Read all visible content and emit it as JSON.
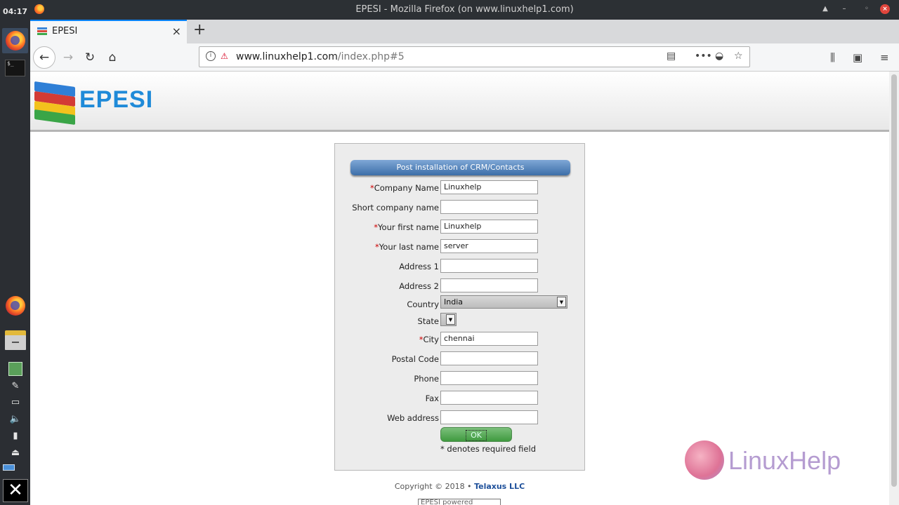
{
  "taskbar": {
    "time": "04:17",
    "terminal_prompt": "$_"
  },
  "window": {
    "title": "EPESI - Mozilla Firefox (on www.linuxhelp1.com)"
  },
  "tab": {
    "label": "EPESI",
    "close": "×",
    "new_tab": "+"
  },
  "nav": {
    "url_domain": "www.linuxhelp1.com",
    "url_path": "/index.php#5",
    "icons": [
      "back-icon",
      "forward-icon",
      "reload-icon",
      "home-icon",
      "info-icon",
      "insecure-icon",
      "reader-icon",
      "more-icon",
      "pocket-icon",
      "bookmark-star-icon",
      "library-icon",
      "sidebar-icon",
      "menu-icon"
    ]
  },
  "brand": {
    "logo_text": "EPESI"
  },
  "form": {
    "title": "Post installation of CRM/Contacts",
    "required_mark": "*",
    "fields": {
      "company_name": {
        "label": "Company Name",
        "value": "Linuxhelp"
      },
      "short_company_name": {
        "label": "Short company name",
        "value": ""
      },
      "first_name": {
        "label": "Your first name",
        "value": "Linuxhelp"
      },
      "last_name": {
        "label": "Your last name",
        "value": "server"
      },
      "address1": {
        "label": "Address 1",
        "value": ""
      },
      "address2": {
        "label": "Address 2",
        "value": ""
      },
      "country": {
        "label": "Country",
        "value": "India"
      },
      "state": {
        "label": "State",
        "value": ""
      },
      "city": {
        "label": "City",
        "value": "chennai"
      },
      "postal_code": {
        "label": "Postal Code",
        "value": ""
      },
      "phone": {
        "label": "Phone",
        "value": ""
      },
      "fax": {
        "label": "Fax",
        "value": ""
      },
      "web_address": {
        "label": "Web address",
        "value": ""
      }
    },
    "ok_label": "OK",
    "required_note": "* denotes required field"
  },
  "footer": {
    "copyright": "Copyright © 2018 •",
    "company": "Telaxus LLC",
    "powered": "EPESI powered"
  },
  "watermark": {
    "text": "LinuxHelp"
  },
  "colors": {
    "accent": "#0a84ff",
    "header_blue": "#3c6ea8",
    "ok_green": "#3f9a3f",
    "required_red": "#cc0000"
  }
}
